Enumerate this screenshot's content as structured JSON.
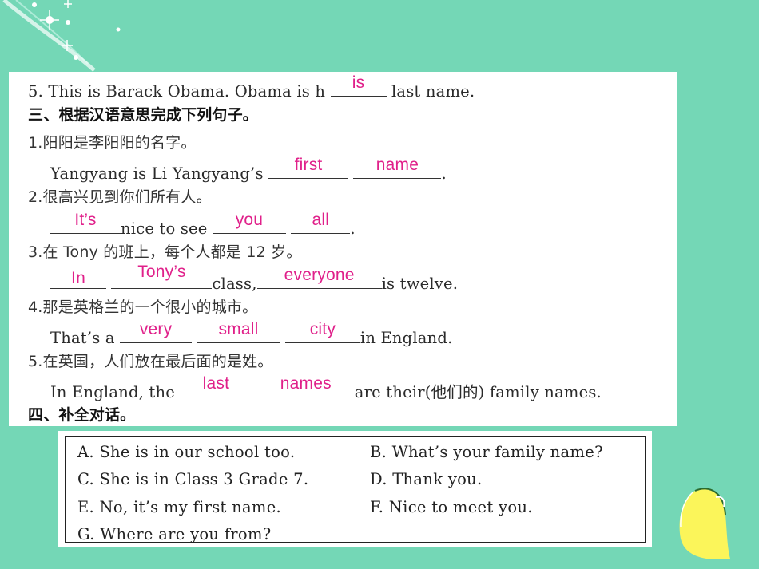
{
  "exercise_prev": {
    "item5": {
      "number": "5.",
      "before": "This is Barack Obama.  Obama is h",
      "answer": "is",
      "after": "last name."
    }
  },
  "section3": {
    "heading": "三、根据汉语意思完成下列句子。",
    "items": [
      {
        "number": "1.",
        "chinese": "阳阳是李阳阳的名字。",
        "english_before": "Yangyang is Li Yangyang’s",
        "answers": [
          "first",
          "name"
        ],
        "english_after": "."
      },
      {
        "number": "2.",
        "chinese": "很高兴见到你们所有人。",
        "answers": [
          "It’s",
          "you",
          "all"
        ],
        "middle": "nice to see",
        "english_after": "."
      },
      {
        "number": "3.",
        "chinese": "在 Tony 的班上，每个人都是 12 岁。",
        "answers": [
          "In",
          "Tony’s",
          "everyone"
        ],
        "middle": "class,",
        "english_after": "is twelve."
      },
      {
        "number": "4.",
        "chinese": "那是英格兰的一个很小的城市。",
        "english_before": "That’s a",
        "answers": [
          "very",
          "small",
          "city"
        ],
        "english_after": "in England."
      },
      {
        "number": "5.",
        "chinese": "在英国，人们放在最后面的是姓。",
        "english_before": "In England, the",
        "answers": [
          "last",
          "names"
        ],
        "english_after": "are their(他们的) family names."
      }
    ]
  },
  "section4": {
    "heading": "四、补全对话。",
    "choices": [
      {
        "label": "A.",
        "text": "She is in our school too."
      },
      {
        "label": "B.",
        "text": "What’s your family name?"
      },
      {
        "label": "C.",
        "text": "She is in Class 3 Grade 7."
      },
      {
        "label": "D.",
        "text": "Thank you."
      },
      {
        "label": "E.",
        "text": "No, it’s my first name."
      },
      {
        "label": "F.",
        "text": "Nice to meet you."
      },
      {
        "label": "G.",
        "text": "Where are you from?"
      }
    ]
  },
  "colors": {
    "background": "#74d7b6",
    "answer": "#e0208a",
    "lemon": "#fbf55a"
  }
}
